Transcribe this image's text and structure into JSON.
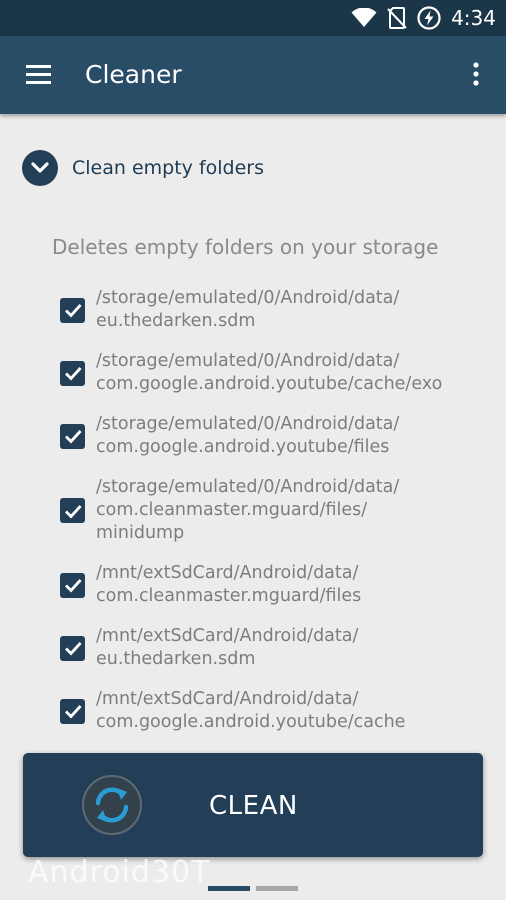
{
  "status_bar": {
    "time": "4:34",
    "icons": [
      "wifi-icon",
      "no-sim-icon",
      "battery-charging-icon"
    ]
  },
  "app_bar": {
    "title": "Cleaner",
    "menu_icon": "hamburger-menu-icon",
    "overflow_icon": "more-vert-icon"
  },
  "section": {
    "title": "Clean empty folders",
    "expand_icon": "chevron-down-icon",
    "description": "Deletes empty folders on your storage"
  },
  "paths": [
    {
      "label": "/storage/emulated/0/Android/data/\neu.thedarken.sdm",
      "checked": true
    },
    {
      "label": "/storage/emulated/0/Android/data/\ncom.google.android.youtube/cache/exo",
      "checked": true
    },
    {
      "label": "/storage/emulated/0/Android/data/\ncom.google.android.youtube/files",
      "checked": true
    },
    {
      "label": "/storage/emulated/0/Android/data/\ncom.cleanmaster.mguard/files/\nminidump",
      "checked": true
    },
    {
      "label": "/mnt/extSdCard/Android/data/\ncom.cleanmaster.mguard/files",
      "checked": true
    },
    {
      "label": "/mnt/extSdCard/Android/data/\neu.thedarken.sdm",
      "checked": true
    },
    {
      "label": "/mnt/extSdCard/Android/data/\ncom.google.android.youtube/cache",
      "checked": true
    }
  ],
  "clean_button": {
    "label": "CLEAN",
    "icon": "sync-icon"
  },
  "watermark": "Android30T",
  "pager": {
    "pages": 2,
    "active_index": 0
  },
  "colors": {
    "primary": "#294c67",
    "primary_dark": "#1c3649",
    "accent": "#223f57",
    "background": "#ececec"
  }
}
